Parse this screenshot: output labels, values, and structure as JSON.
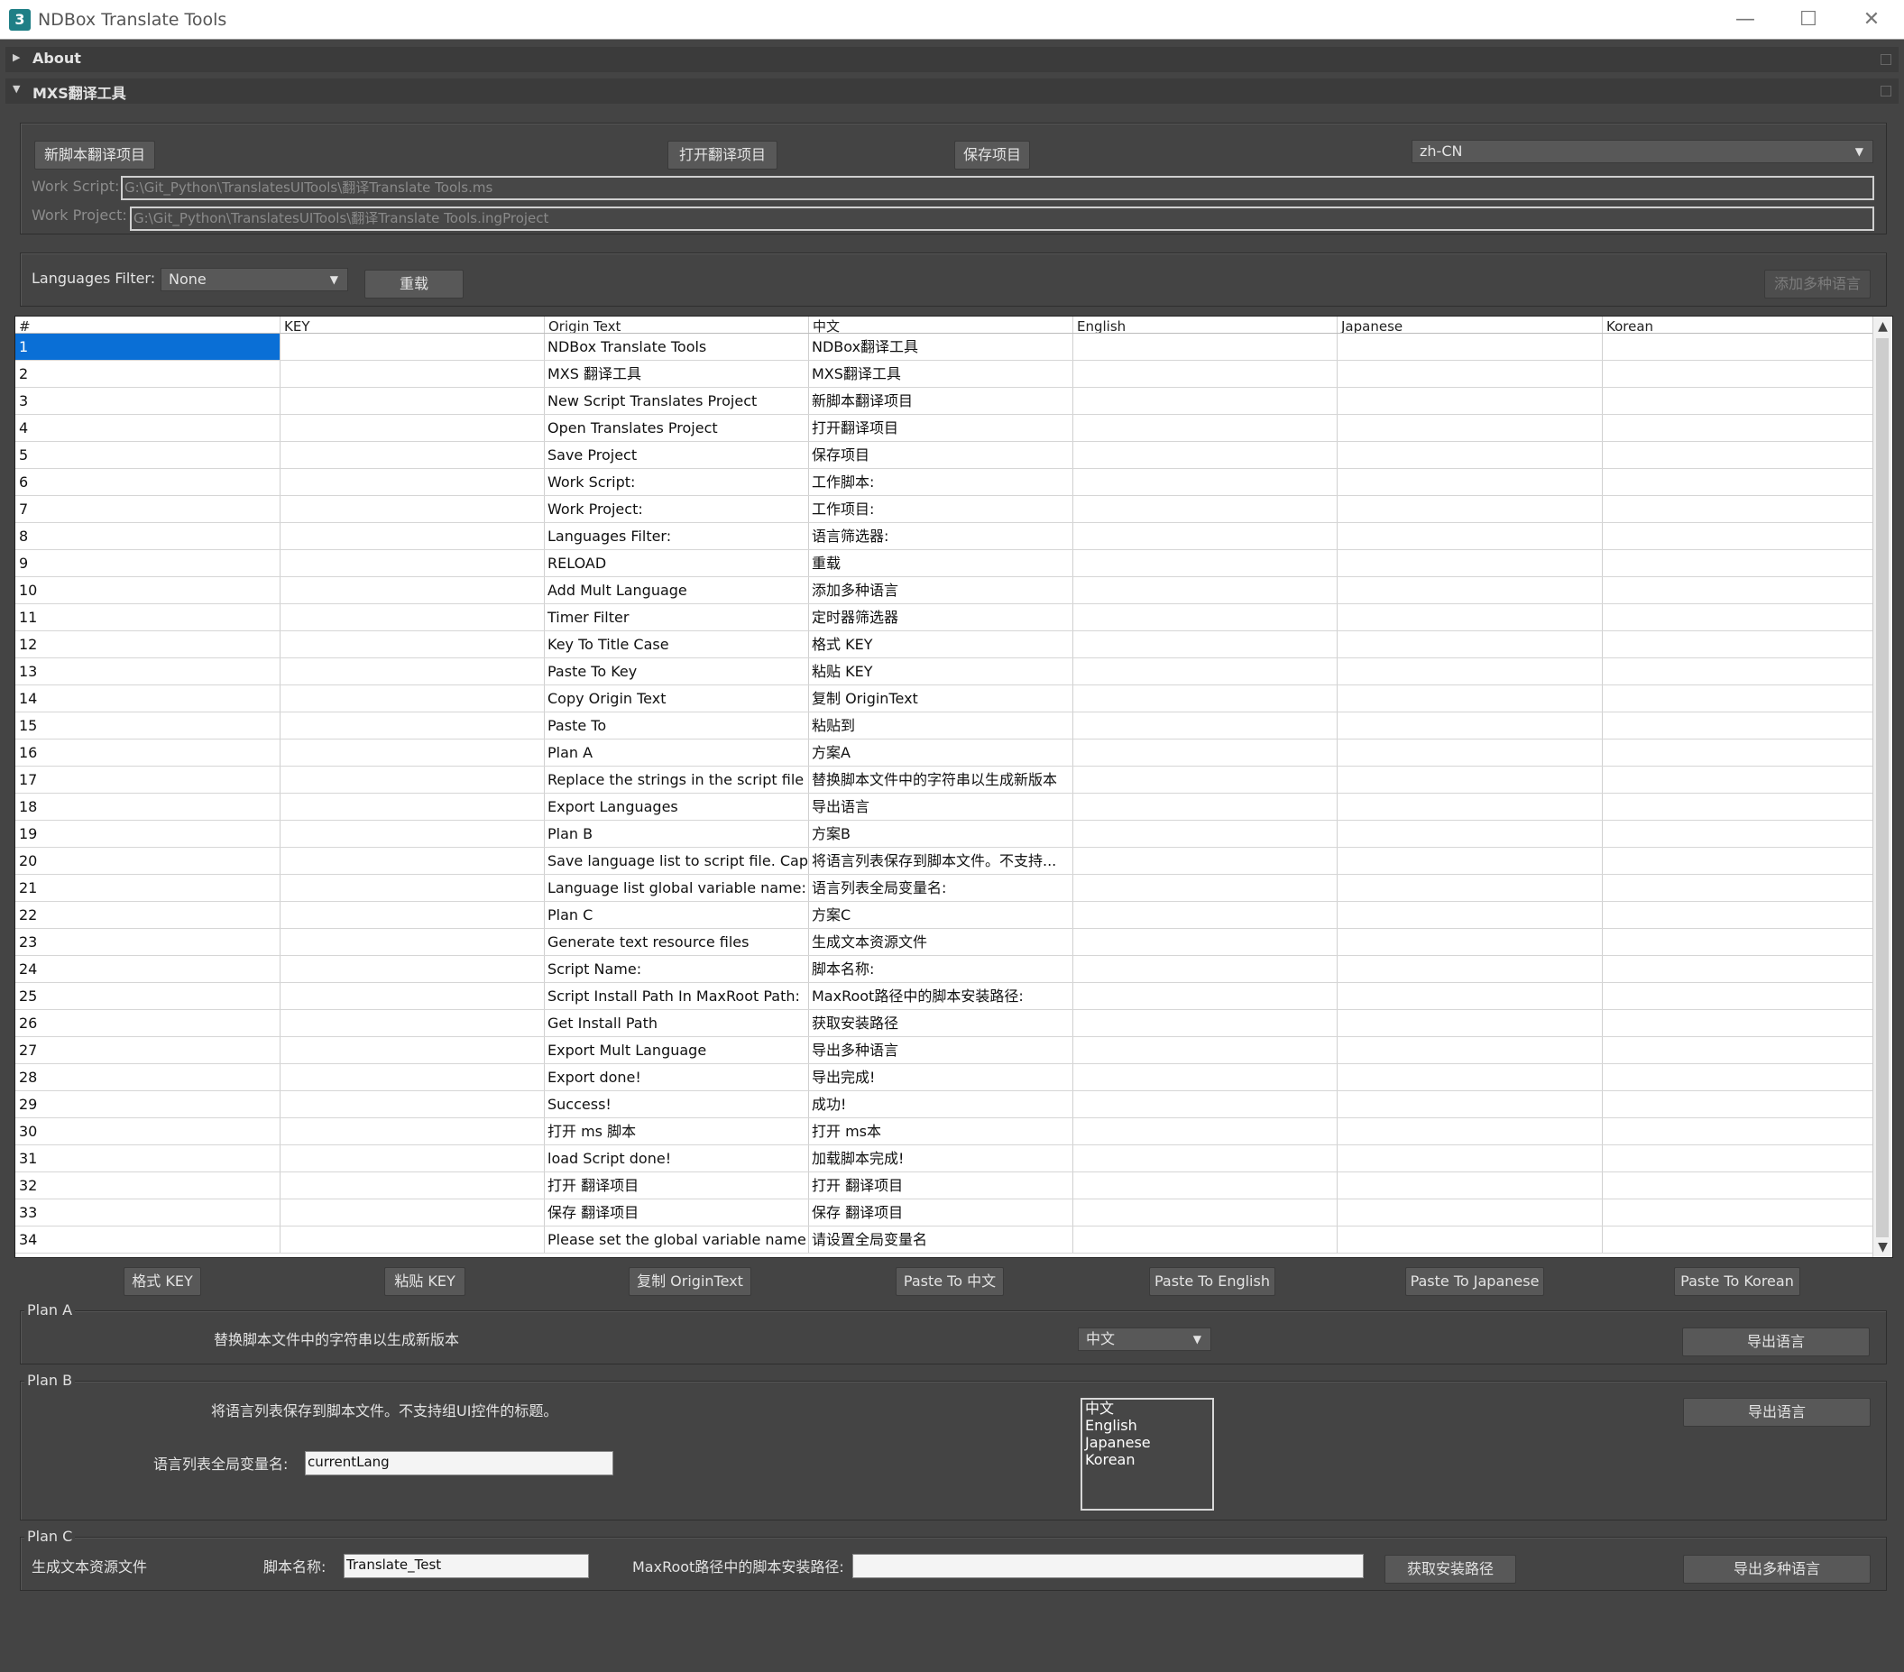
{
  "window": {
    "title": "NDBox Translate Tools",
    "minimize": "—",
    "maximize": "☐",
    "close": "✕"
  },
  "rollouts": {
    "about": "About",
    "mxs": "MXS翻译工具"
  },
  "top": {
    "new_project": "新脚本翻译项目",
    "open_project": "打开翻译项目",
    "save_project": "保存项目",
    "locale_value": "zh-CN",
    "work_script_label": "Work Script:",
    "work_script_value": "G:\\Git_Python\\TranslatesUITools\\翻译Translate Tools.ms",
    "work_project_label": "Work Project:",
    "work_project_value": "G:\\Git_Python\\TranslatesUITools\\翻译Translate Tools.ingProject"
  },
  "filter": {
    "label": "Languages Filter:",
    "value": "None",
    "reload": "重载",
    "add_mult": "添加多种语言"
  },
  "grid": {
    "columns": [
      "#",
      "KEY",
      "Origin Text",
      "中文",
      "English",
      "Japanese",
      "Korean"
    ],
    "rows": [
      [
        "1",
        "",
        "NDBox Translate Tools",
        "NDBox翻译工具",
        "",
        "",
        ""
      ],
      [
        "2",
        "",
        "MXS 翻译工具",
        "MXS翻译工具",
        "",
        "",
        ""
      ],
      [
        "3",
        "",
        "New Script Translates Project",
        "新脚本翻译项目",
        "",
        "",
        ""
      ],
      [
        "4",
        "",
        "Open Translates Project",
        "打开翻译项目",
        "",
        "",
        ""
      ],
      [
        "5",
        "",
        "Save Project",
        "保存项目",
        "",
        "",
        ""
      ],
      [
        "6",
        "",
        "Work Script:",
        "工作脚本:",
        "",
        "",
        ""
      ],
      [
        "7",
        "",
        "Work Project:",
        "工作项目:",
        "",
        "",
        ""
      ],
      [
        "8",
        "",
        "Languages Filter:",
        "语言筛选器:",
        "",
        "",
        ""
      ],
      [
        "9",
        "",
        "RELOAD",
        "重载",
        "",
        "",
        ""
      ],
      [
        "10",
        "",
        "Add Mult Language",
        "添加多种语言",
        "",
        "",
        ""
      ],
      [
        "11",
        "",
        "Timer Filter",
        "定时器筛选器",
        "",
        "",
        ""
      ],
      [
        "12",
        "",
        "Key To Title Case",
        "格式 KEY",
        "",
        "",
        ""
      ],
      [
        "13",
        "",
        "Paste To Key",
        "粘贴 KEY",
        "",
        "",
        ""
      ],
      [
        "14",
        "",
        "Copy Origin Text",
        "复制 OriginText",
        "",
        "",
        ""
      ],
      [
        "15",
        "",
        "Paste To",
        "粘贴到",
        "",
        "",
        ""
      ],
      [
        "16",
        "",
        "Plan A",
        "方案A",
        "",
        "",
        ""
      ],
      [
        "17",
        "",
        "Replace the strings in the script file to...",
        "替换脚本文件中的字符串以生成新版本",
        "",
        "",
        ""
      ],
      [
        "18",
        "",
        "Export Languages",
        "导出语言",
        "",
        "",
        ""
      ],
      [
        "19",
        "",
        "Plan B",
        "方案B",
        "",
        "",
        ""
      ],
      [
        "20",
        "",
        "Save language list to script file. Capti...",
        "将语言列表保存到脚本文件。不支持...",
        "",
        "",
        ""
      ],
      [
        "21",
        "",
        "Language list global variable name:",
        "语言列表全局变量名:",
        "",
        "",
        ""
      ],
      [
        "22",
        "",
        "Plan C",
        "方案C",
        "",
        "",
        ""
      ],
      [
        "23",
        "",
        "Generate text resource files",
        "生成文本资源文件",
        "",
        "",
        ""
      ],
      [
        "24",
        "",
        "Script Name:",
        "脚本名称:",
        "",
        "",
        ""
      ],
      [
        "25",
        "",
        "Script Install Path In MaxRoot Path:",
        "MaxRoot路径中的脚本安装路径:",
        "",
        "",
        ""
      ],
      [
        "26",
        "",
        "Get Install Path",
        "获取安装路径",
        "",
        "",
        ""
      ],
      [
        "27",
        "",
        "Export Mult Language",
        "导出多种语言",
        "",
        "",
        ""
      ],
      [
        "28",
        "",
        "Export done!",
        "导出完成!",
        "",
        "",
        ""
      ],
      [
        "29",
        "",
        "Success!",
        "成功!",
        "",
        "",
        ""
      ],
      [
        "30",
        "",
        "打开 ms 脚本",
        "打开 ms本",
        "",
        "",
        ""
      ],
      [
        "31",
        "",
        "load Script done!",
        "加载脚本完成!",
        "",
        "",
        ""
      ],
      [
        "32",
        "",
        "打开 翻译项目",
        "打开 翻译项目",
        "",
        "",
        ""
      ],
      [
        "33",
        "",
        "保存 翻译项目",
        "保存 翻译项目",
        "",
        "",
        ""
      ],
      [
        "34",
        "",
        "Please set the global variable name",
        "请设置全局变量名",
        "",
        "",
        ""
      ]
    ],
    "scroll_up": "▲",
    "scroll_down": "▼"
  },
  "actions": {
    "key_title_case": "格式 KEY",
    "paste_key": "粘贴 KEY",
    "copy_origin": "复制 OriginText",
    "paste_zh": "Paste To 中文",
    "paste_en": "Paste To English",
    "paste_ja": "Paste To Japanese",
    "paste_ko": "Paste To Korean"
  },
  "plan_a": {
    "title": "Plan A",
    "desc": "替换脚本文件中的字符串以生成新版本",
    "lang_value": "中文",
    "export": "导出语言"
  },
  "plan_b": {
    "title": "Plan B",
    "desc": "将语言列表保存到脚本文件。不支持组UI控件的标题。",
    "var_label": "语言列表全局变量名:",
    "var_value": "currentLang",
    "languages": [
      "中文",
      "English",
      "Japanese",
      "Korean"
    ],
    "export": "导出语言"
  },
  "plan_c": {
    "title": "Plan C",
    "desc": "生成文本资源文件",
    "name_label": "脚本名称:",
    "name_value": "Translate_Test",
    "path_label": "MaxRoot路径中的脚本安装路径:",
    "path_value": "",
    "get_path": "获取安装路径",
    "export_mult": "导出多种语言"
  },
  "colors": {
    "background": "#444444",
    "selection": "#0a6fd6",
    "grid_bg": "#ffffff"
  }
}
